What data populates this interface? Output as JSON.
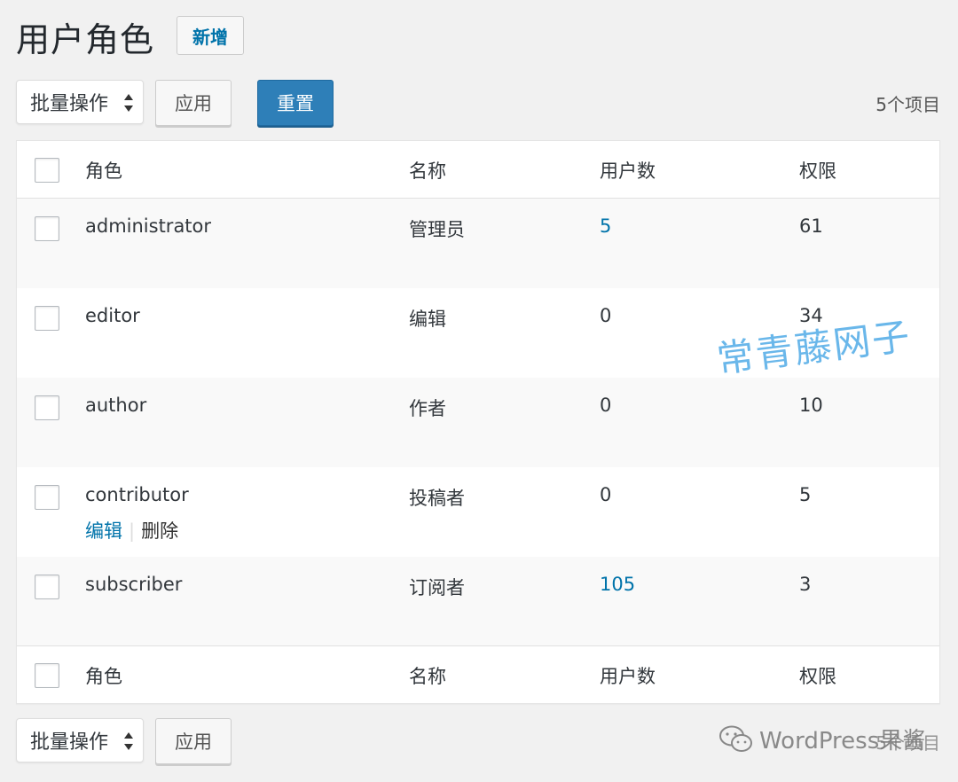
{
  "header": {
    "title": "用户角色",
    "add_new_label": "新增"
  },
  "tablenav_top": {
    "bulk_action": "批量操作",
    "apply_label": "应用",
    "reset_label": "重置",
    "item_count": "5个项目"
  },
  "columns": {
    "role": "角色",
    "name": "名称",
    "users": "用户数",
    "caps": "权限"
  },
  "rows": [
    {
      "role": "administrator",
      "name": "管理员",
      "users": "5",
      "caps": "61",
      "users_link": true
    },
    {
      "role": "editor",
      "name": "编辑",
      "users": "0",
      "caps": "34",
      "users_link": false
    },
    {
      "role": "author",
      "name": "作者",
      "users": "0",
      "caps": "10",
      "users_link": false
    },
    {
      "role": "contributor",
      "name": "投稿者",
      "users": "0",
      "caps": "5",
      "users_link": false,
      "actions": {
        "edit": "编辑",
        "separator": "|",
        "delete": "删除"
      }
    },
    {
      "role": "subscriber",
      "name": "订阅者",
      "users": "105",
      "caps": "3",
      "users_link": true
    }
  ],
  "tablenav_bottom": {
    "bulk_action": "批量操作",
    "apply_label": "应用",
    "item_count": "5个项目"
  },
  "watermark": {
    "text": "常青藤网子",
    "color": "#5ab0e8"
  },
  "wechat_mark": {
    "text": "WordPress果酱",
    "icon": "wechat-icon"
  },
  "colors": {
    "link": "#0073aa",
    "primary_button": "#2e7fb8",
    "background": "#f1f1f1"
  }
}
